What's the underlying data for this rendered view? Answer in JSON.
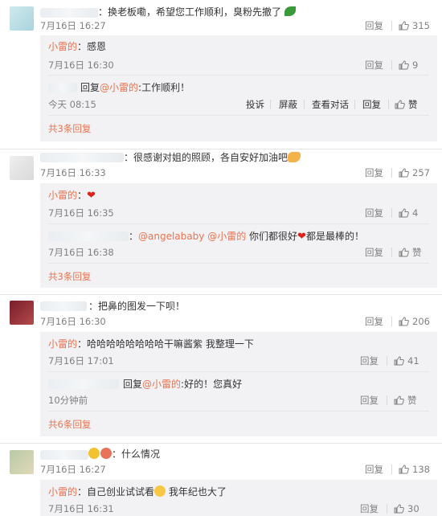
{
  "comments": [
    {
      "text": "：换老板嘞，希望您工作顺利，臭粉先撤了",
      "time": "7月16日 16:27",
      "likes": "315",
      "replies": [
        {
          "name": "小雷的",
          "text": "：感恩",
          "time": "7月16日 16:30",
          "likes": "9"
        },
        {
          "prefix": "回复",
          "at": "@小雷的",
          "text": ":工作顺利！",
          "time": "今天 08:15",
          "actions": [
            "投诉",
            "屏蔽",
            "查看对话",
            "回复",
            "赞"
          ]
        }
      ],
      "more": "共3条回复"
    },
    {
      "text": "：很感谢对姐的照顾，各自安好加油吧",
      "time": "7月16日 16:33",
      "likes": "257",
      "replies": [
        {
          "name": "小雷的",
          "text": "：",
          "time": "7月16日 16:35",
          "likes": "4"
        },
        {
          "text_pre": "：",
          "at1": "@angelababy",
          "at2": "@小雷的",
          "text": " 你们都很好",
          "text_post": "都是最棒的！",
          "time": "7月16日 16:38",
          "likes": "赞"
        }
      ],
      "more": "共3条回复"
    },
    {
      "text": "：把鼻的图发一下呗！",
      "time": "7月16日 16:30",
      "likes": "206",
      "replies": [
        {
          "name": "小雷的",
          "text": "：哈哈哈哈哈哈哈哈干嘛酱紫 我整理一下",
          "time": "7月16日 17:01",
          "likes": "41"
        },
        {
          "prefix": "回复",
          "at": "@小雷的",
          "text": ":好的！您真好",
          "time": "10分钟前",
          "likes": "赞"
        }
      ],
      "more": "共6条回复"
    },
    {
      "text": "：什么情况",
      "time": "7月16日 16:27",
      "likes": "138",
      "replies": [
        {
          "name": "小雷的",
          "text": "：自己创业试试看",
          "text_post": " 我年纪也大了",
          "time": "7月16日 16:31",
          "likes": "30"
        }
      ]
    }
  ],
  "reply_label": "回复",
  "colors": {
    "accent": "#eb7350",
    "box": "#f2f2f5",
    "meta": "#808080"
  },
  "icons": [
    "thumb-up-icon",
    "heart-icon",
    "smile-emoji-icon",
    "leaf-emoji-icon",
    "muscle-emoji-icon"
  ]
}
